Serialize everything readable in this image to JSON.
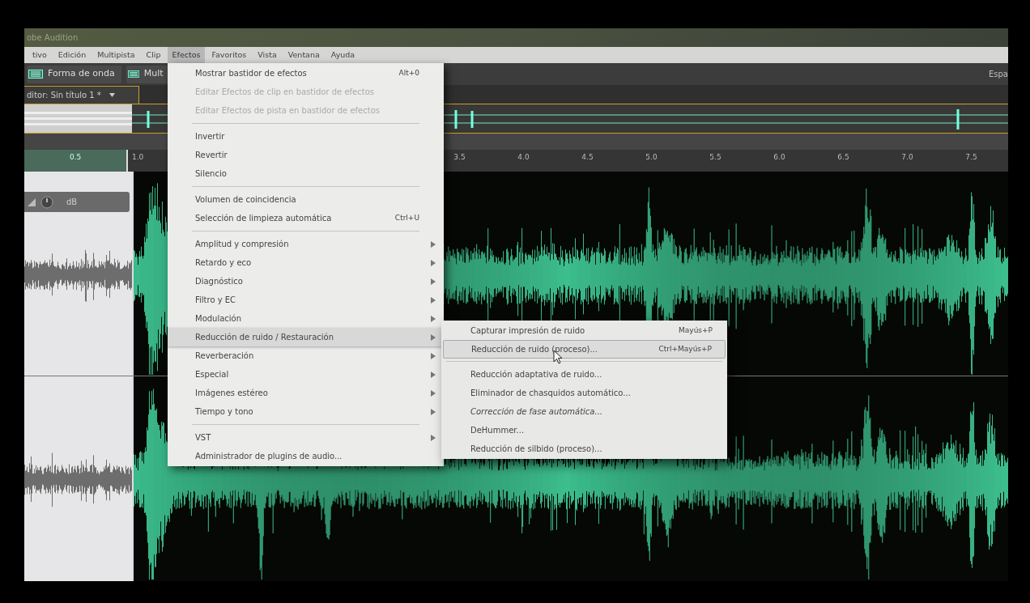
{
  "app": {
    "title": "obe Audition"
  },
  "menubar": [
    {
      "label": "tivo",
      "selected": false
    },
    {
      "label": "Edición",
      "selected": false
    },
    {
      "label": "Multipista",
      "selected": false
    },
    {
      "label": "Clip",
      "selected": false
    },
    {
      "label": "Efectos",
      "selected": true
    },
    {
      "label": "Favoritos",
      "selected": false
    },
    {
      "label": "Vista",
      "selected": false
    },
    {
      "label": "Ventana",
      "selected": false
    },
    {
      "label": "Ayuda",
      "selected": false
    }
  ],
  "toolbar": {
    "buttons": [
      {
        "label": "Forma de onda"
      },
      {
        "label": "Mult"
      }
    ],
    "workspace": "Espa"
  },
  "editor_tab": {
    "label": "ditor: Sin título 1 *"
  },
  "ruler": {
    "left_labels": [
      "0.5"
    ],
    "right_labels": [
      "1.0",
      "3.5",
      "4.0",
      "4.5",
      "5.0",
      "5.5",
      "6.0",
      "6.5",
      "7.0",
      "7.5"
    ]
  },
  "hud": {
    "unit": "dB"
  },
  "menu": {
    "items": [
      {
        "kind": "item",
        "label": "Mostrar bastidor de efectos",
        "shortcut": "Alt+0",
        "disabled": false,
        "submenu": false,
        "selected": false
      },
      {
        "kind": "item",
        "label": "Editar Efectos de clip en bastidor de efectos",
        "disabled": true,
        "submenu": false,
        "selected": false
      },
      {
        "kind": "item",
        "label": "Editar Efectos de pista en bastidor de efectos",
        "disabled": true,
        "submenu": false,
        "selected": false
      },
      {
        "kind": "separator"
      },
      {
        "kind": "item",
        "label": "Invertir",
        "disabled": false,
        "submenu": false,
        "selected": false
      },
      {
        "kind": "item",
        "label": "Revertir",
        "disabled": false,
        "submenu": false,
        "selected": false
      },
      {
        "kind": "item",
        "label": "Silencio",
        "disabled": false,
        "submenu": false,
        "selected": false
      },
      {
        "kind": "separator"
      },
      {
        "kind": "item",
        "label": "Volumen de coincidencia",
        "disabled": false,
        "submenu": false,
        "selected": false
      },
      {
        "kind": "item",
        "label": "Selección de limpieza automática",
        "shortcut": "Ctrl+U",
        "disabled": false,
        "submenu": false,
        "selected": false
      },
      {
        "kind": "separator"
      },
      {
        "kind": "item",
        "label": "Amplitud y compresión",
        "disabled": false,
        "submenu": true,
        "selected": false
      },
      {
        "kind": "item",
        "label": "Retardo y eco",
        "disabled": false,
        "submenu": true,
        "selected": false
      },
      {
        "kind": "item",
        "label": "Diagnóstico",
        "disabled": false,
        "submenu": true,
        "selected": false
      },
      {
        "kind": "item",
        "label": "Filtro y EC",
        "disabled": false,
        "submenu": true,
        "selected": false
      },
      {
        "kind": "item",
        "label": "Modulación",
        "disabled": false,
        "submenu": true,
        "selected": false
      },
      {
        "kind": "item",
        "label": "Reducción de ruido / Restauración",
        "disabled": false,
        "submenu": true,
        "selected": true
      },
      {
        "kind": "item",
        "label": "Reverberación",
        "disabled": false,
        "submenu": true,
        "selected": false
      },
      {
        "kind": "item",
        "label": "Especial",
        "disabled": false,
        "submenu": true,
        "selected": false
      },
      {
        "kind": "item",
        "label": "Imágenes estéreo",
        "disabled": false,
        "submenu": true,
        "selected": false
      },
      {
        "kind": "item",
        "label": "Tiempo y tono",
        "disabled": false,
        "submenu": true,
        "selected": false
      },
      {
        "kind": "separator"
      },
      {
        "kind": "item",
        "label": "VST",
        "disabled": false,
        "submenu": true,
        "selected": false
      },
      {
        "kind": "item",
        "label": "Administrador de plugins de audio...",
        "disabled": false,
        "submenu": false,
        "selected": false
      }
    ]
  },
  "submenu": {
    "items": [
      {
        "kind": "item",
        "label": "Capturar impresión de ruido",
        "shortcut": "Mayús+P",
        "italic": false,
        "selected": false
      },
      {
        "kind": "item",
        "label": "Reducción de ruido (proceso)...",
        "shortcut": "Ctrl+Mayús+P",
        "italic": false,
        "selected": true
      },
      {
        "kind": "separator"
      },
      {
        "kind": "item",
        "label": "Reducción adaptativa de ruido...",
        "italic": false,
        "selected": false
      },
      {
        "kind": "item",
        "label": "Eliminador de chasquidos automático...",
        "italic": false,
        "selected": false
      },
      {
        "kind": "item",
        "label": "Corrección de fase automática...",
        "italic": true,
        "selected": false
      },
      {
        "kind": "item",
        "label": "DeHummer...",
        "italic": false,
        "selected": false
      },
      {
        "kind": "item",
        "label": "Reducción de silbido (proceso)...",
        "italic": false,
        "selected": false
      }
    ]
  }
}
